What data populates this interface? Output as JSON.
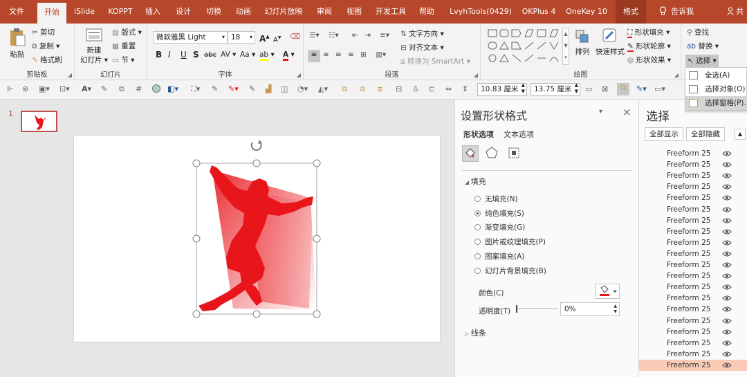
{
  "tabs": [
    "文件",
    "开始",
    "iSlide",
    "KOPPT",
    "插入",
    "设计",
    "切换",
    "动画",
    "幻灯片放映",
    "审阅",
    "视图",
    "开发工具",
    "帮助",
    "LvyhTools(0429)",
    "OKPlus 4",
    "OneKey 10",
    "格式"
  ],
  "tell_me": "告诉我",
  "share": "共",
  "ribbon": {
    "clipboard": {
      "label": "剪贴板",
      "paste": "粘贴",
      "cut": "剪切",
      "copy": "复制",
      "format_painter": "格式刷"
    },
    "slides": {
      "label": "幻灯片",
      "new_slide_1": "新建",
      "new_slide_2": "幻灯片",
      "layout": "版式",
      "reset": "重置",
      "section": "节"
    },
    "font": {
      "label": "字体",
      "font_name": "微软雅黑 Light",
      "font_size": "18",
      "bold": "B",
      "italic": "I",
      "underline": "U",
      "shadow": "S",
      "strike": "abc",
      "spacing": "AV",
      "case": "Aa",
      "grow": "A",
      "shrink": "A"
    },
    "paragraph": {
      "label": "段落",
      "text_direction": "文字方向",
      "align_text": "对齐文本",
      "smartart": "转换为 SmartArt"
    },
    "drawing": {
      "label": "绘图",
      "arrange": "排列",
      "quick_styles": "快速样式",
      "shape_fill": "形状填充",
      "shape_outline": "形状轮廓",
      "shape_effects": "形状效果"
    },
    "editing": {
      "find": "查找",
      "replace": "替换",
      "select": "选择"
    }
  },
  "quickbar": {
    "width": "10.83 厘米",
    "height": "13.75 厘米"
  },
  "thumbs": {
    "slide_number": "1"
  },
  "format_pane": {
    "title": "设置形状格式",
    "tab_shape": "形状选项",
    "tab_text": "文本选项",
    "fill_header": "填充",
    "options": [
      "无填充(N)",
      "纯色填充(S)",
      "渐变填充(G)",
      "图片或纹理填充(P)",
      "图案填充(A)",
      "幻灯片背景填充(B)"
    ],
    "selected_option": 1,
    "color_label": "颜色(C)",
    "transparency_label": "透明度(T)",
    "transparency_value": "0%",
    "line_header": "线条"
  },
  "select_pane": {
    "title": "选择",
    "show_all": "全部显示",
    "hide_all": "全部隐藏",
    "items": [
      "Freeform 25",
      "Freeform 25",
      "Freeform 25",
      "Freeform 25",
      "Freeform 25",
      "Freeform 25",
      "Freeform 25",
      "Freeform 25",
      "Freeform 25",
      "Freeform 25",
      "Freeform 25",
      "Freeform 25",
      "Freeform 25",
      "Freeform 25",
      "Freeform 25",
      "Freeform 25",
      "Freeform 25",
      "Freeform 25",
      "Freeform 25",
      "Freeform 25"
    ],
    "selected_index": 19
  },
  "select_menu": {
    "items": [
      "全选(A)",
      "选择对象(O)",
      "选择窗格(P)..."
    ],
    "highlighted": 2
  },
  "colors": {
    "accent": "#b7472a",
    "shape_red": "#e8161b",
    "highlight": "#f9cbb7"
  },
  "icons": {
    "close": "×",
    "collapse": "▾",
    "eye": "eye-icon"
  }
}
